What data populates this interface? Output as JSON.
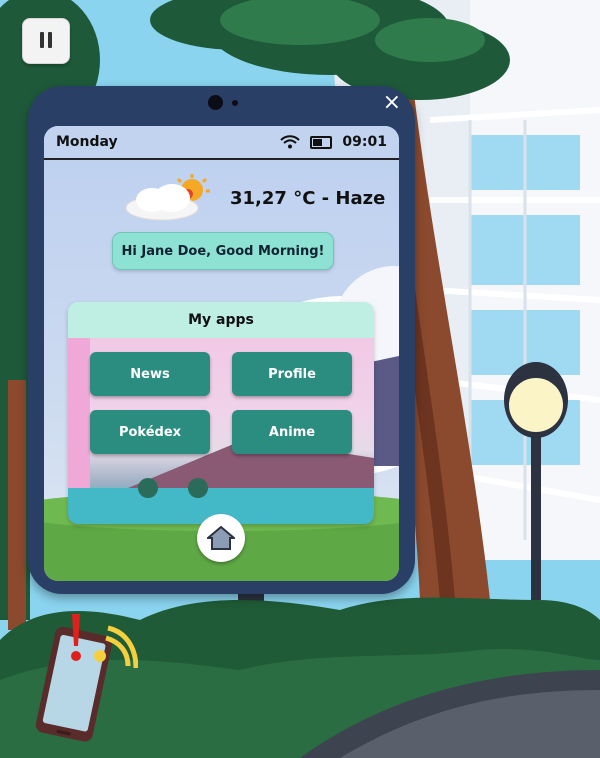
{
  "tablet": {
    "status_day": "Monday",
    "status_time": "09:01",
    "weather_text": "31,27 °C - Haze",
    "greeting": "Hi Jane Doe, Good Morning!",
    "apps_title": "My apps",
    "apps": [
      {
        "label": "News"
      },
      {
        "label": "Profile"
      },
      {
        "label": "Pokédex"
      },
      {
        "label": "Anime"
      }
    ],
    "close_label": "×"
  },
  "colors": {
    "tablet_frame": "#293f66",
    "app_button": "#2a8d80",
    "greeting_bg": "#8ee2d3",
    "apps_header_bg": "#bfeee3"
  },
  "icons": {
    "pause": "pause-icon",
    "wifi": "wifi-icon",
    "battery": "battery-icon",
    "weather": "cloud-sun-icon",
    "home": "home-icon",
    "notification": "phone-notification-icon"
  }
}
